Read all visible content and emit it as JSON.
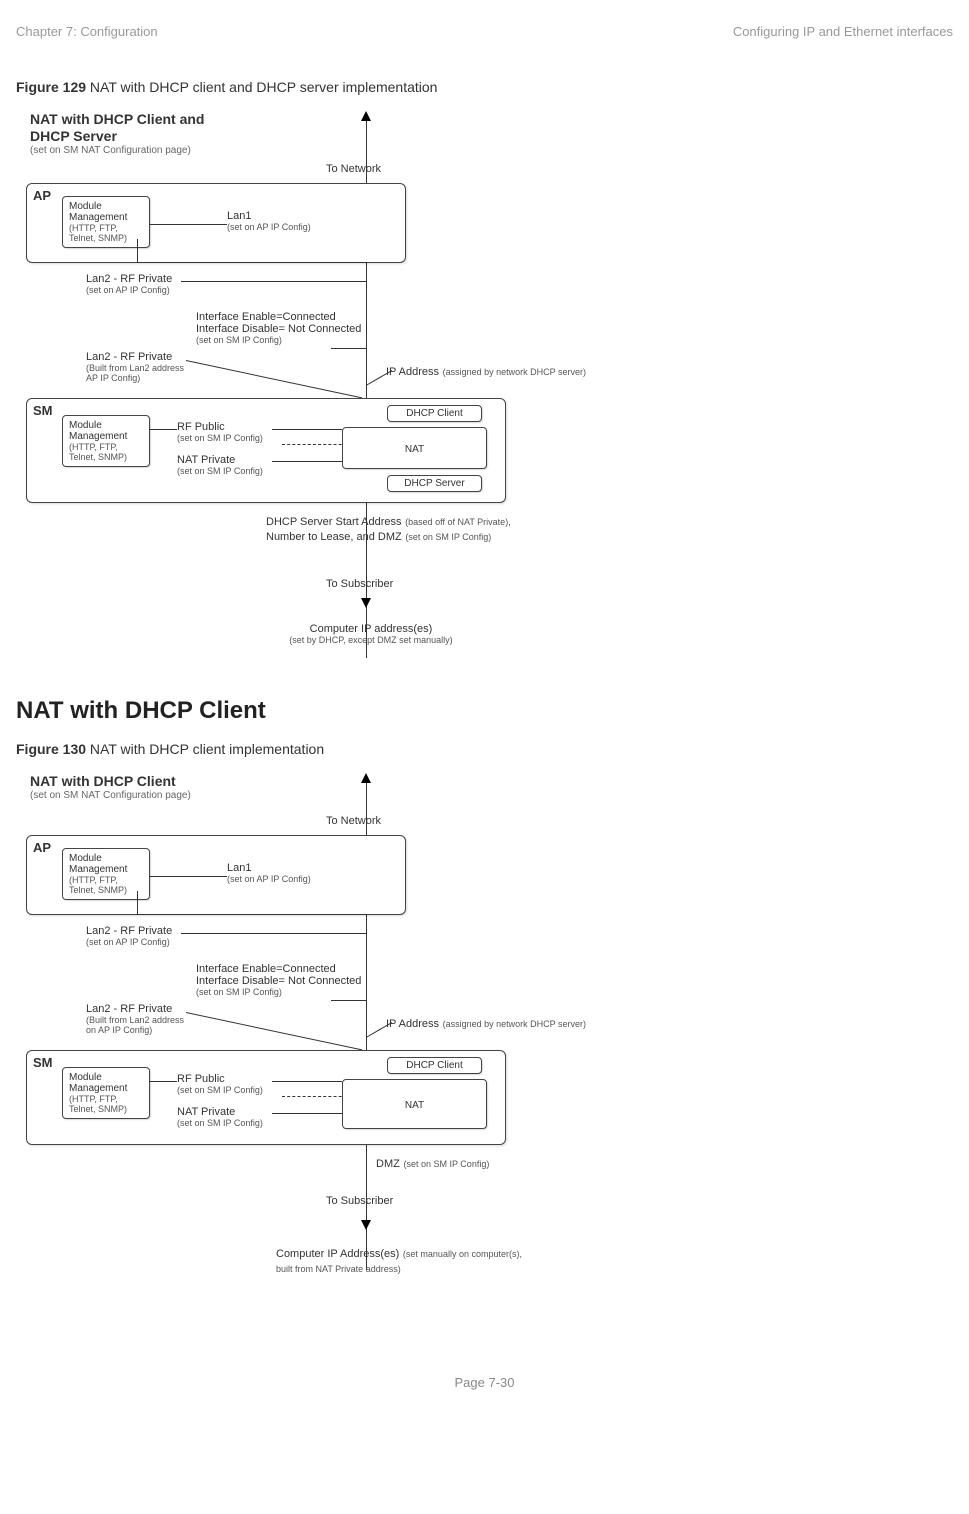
{
  "header": {
    "left": "Chapter 7:  Configuration",
    "right": "Configuring IP and Ethernet interfaces"
  },
  "fig129": {
    "caption_bold": "Figure 129",
    "caption_rest": " NAT with DHCP client and DHCP server implementation",
    "title_line1": "NAT with DHCP Client and",
    "title_line2": "DHCP Server",
    "title_sub": "(set on SM NAT Configuration page)",
    "to_network": "To Network",
    "ap": "AP",
    "module": "Module Management",
    "module_sub": "(HTTP, FTP, Telnet, SNMP)",
    "lan1": "Lan1",
    "lan1_sub": "(set on AP IP Config)",
    "lan2": "Lan2 - RF Private",
    "lan2_sub": "(set on AP IP Config)",
    "if_enable": "Interface Enable=Connected",
    "if_disable": "Interface Disable= Not Connected",
    "if_sub": "(set on SM IP Config)",
    "lan2b": "Lan2 - RF Private",
    "lan2b_sub1": "(Built from Lan2 address",
    "lan2b_sub2": "AP IP Config)",
    "ip_addr": "IP Address",
    "ip_addr_sub": "(assigned by network DHCP server)",
    "sm": "SM",
    "rf_public": "RF Public",
    "rf_public_sub": "(set on SM IP Config)",
    "nat_private": "NAT Private",
    "nat_private_sub": "(set on SM IP Config)",
    "dhcp_client": "DHCP Client",
    "nat": "NAT",
    "dhcp_server": "DHCP Server",
    "dhcp_start": "DHCP Server Start Address",
    "dhcp_start_sub": "(based off of NAT Private),",
    "num_lease": "Number to Lease, and DMZ",
    "num_lease_sub": "(set on SM IP Config)",
    "to_sub": "To Subscriber",
    "comp_ip": "Computer IP address(es)",
    "comp_ip_sub": "(set by DHCP, except DMZ set manually)"
  },
  "section_title": "NAT with DHCP Client",
  "fig130": {
    "caption_bold": "Figure 130",
    "caption_rest": " NAT with DHCP client implementation",
    "title_line1": "NAT with DHCP Client",
    "title_sub": "(set on SM NAT Configuration page)",
    "to_network": "To Network",
    "ap": "AP",
    "module": "Module Management",
    "module_sub": "(HTTP, FTP, Telnet, SNMP)",
    "lan1": "Lan1",
    "lan1_sub": "(set on AP IP Config)",
    "lan2": "Lan2 - RF Private",
    "lan2_sub": "(set on AP IP Config)",
    "if_enable": "Interface Enable=Connected",
    "if_disable": "Interface Disable= Not Connected",
    "if_sub": "(set on SM IP Config)",
    "lan2b": "Lan2 - RF Private",
    "lan2b_sub1": "(Built from Lan2 address",
    "lan2b_sub2": "on AP IP Config)",
    "ip_addr": "IP Address",
    "ip_addr_sub": "(assigned by network DHCP server)",
    "sm": "SM",
    "rf_public": "RF Public",
    "rf_public_sub": "(set on SM IP Config)",
    "nat_private": "NAT Private",
    "nat_private_sub": "(set on SM IP Config)",
    "dhcp_client": "DHCP Client",
    "nat": "NAT",
    "dmz": "DMZ",
    "dmz_sub": "(set on SM IP Config)",
    "to_sub": "To Subscriber",
    "comp_ip": "Computer IP Address(es)",
    "comp_ip_sub": "(set manually on computer(s), built from NAT Private address)"
  },
  "footer": "Page 7-30"
}
